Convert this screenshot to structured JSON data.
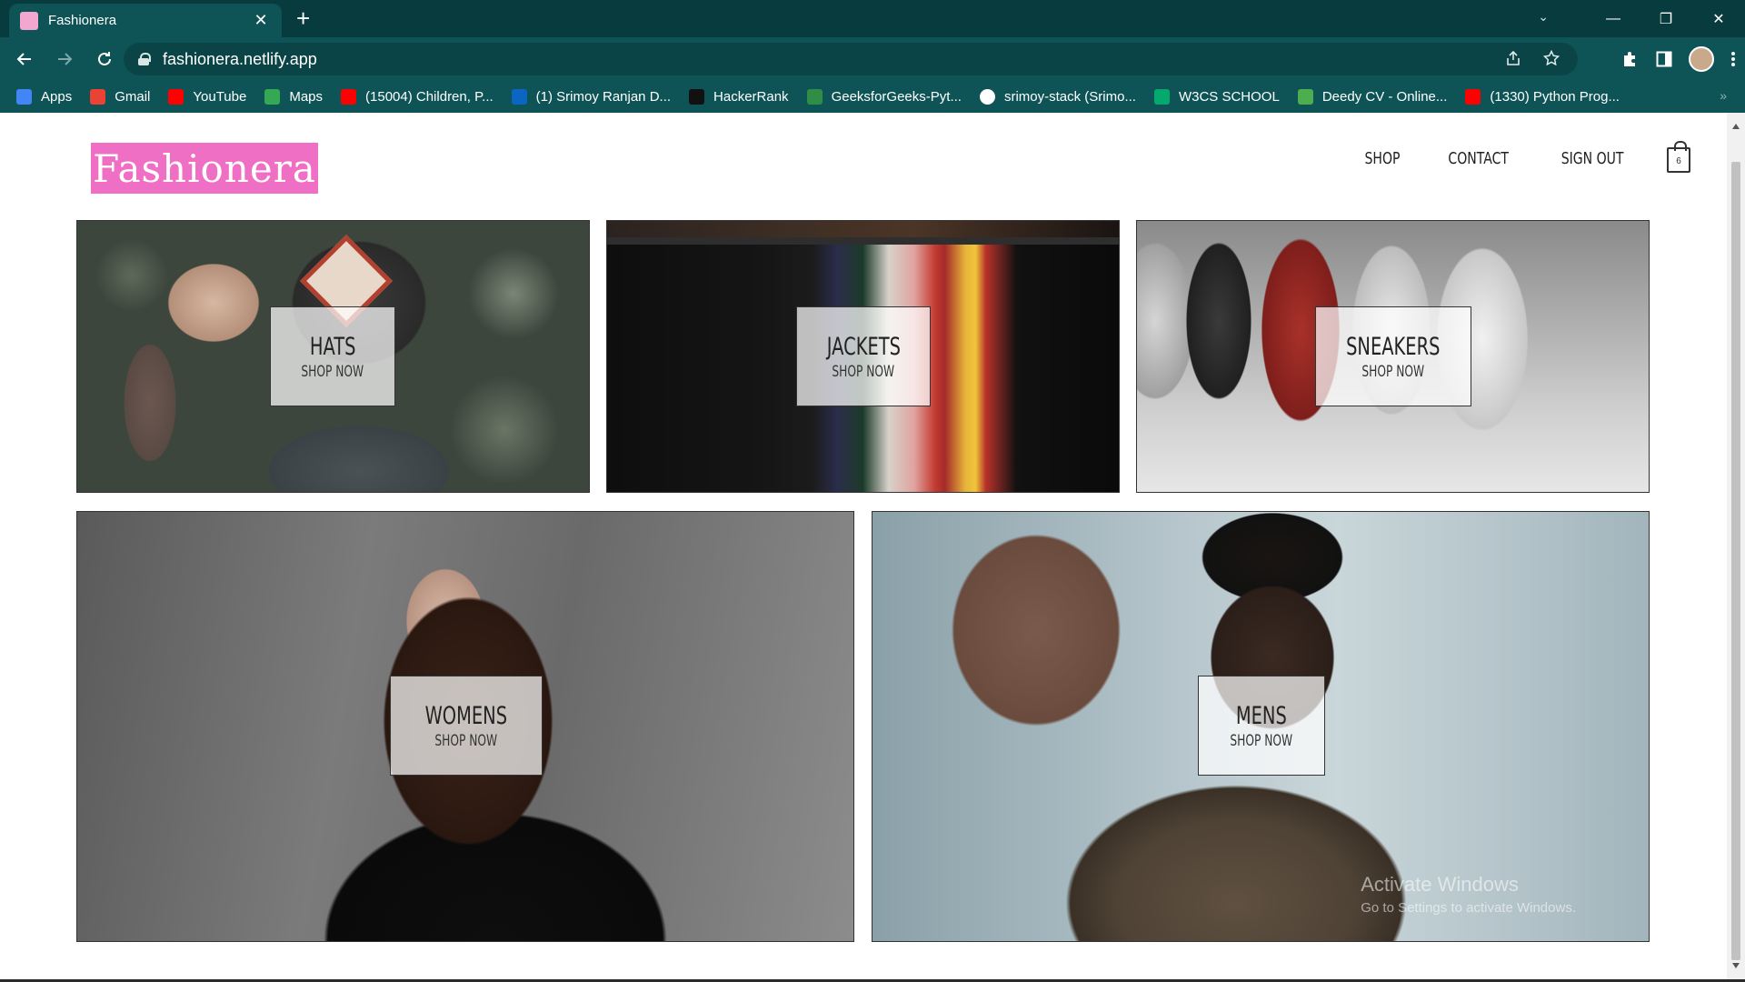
{
  "browser": {
    "tab_title": "Fashionera",
    "tab_close": "✕",
    "new_tab": "+",
    "url": "fashionera.netlify.app",
    "window_controls": {
      "minimize": "—",
      "restore": "❐",
      "close": "✕"
    },
    "tab_search": "⌄",
    "bookmarks": [
      {
        "label": "Apps",
        "icon": "apps-grid-icon",
        "color": "#4285f4"
      },
      {
        "label": "Gmail",
        "icon": "gmail-icon",
        "color": "#ea4335"
      },
      {
        "label": "YouTube",
        "icon": "youtube-icon",
        "color": "#ff0000"
      },
      {
        "label": "Maps",
        "icon": "maps-icon",
        "color": "#34a853"
      },
      {
        "label": "(15004) Children, P...",
        "icon": "youtube-icon",
        "color": "#ff0000"
      },
      {
        "label": "(1) Srimoy Ranjan D...",
        "icon": "linkedin-icon",
        "color": "#0a66c2"
      },
      {
        "label": "HackerRank",
        "icon": "hackerrank-icon",
        "color": "#111111"
      },
      {
        "label": "GeeksforGeeks-Pyt...",
        "icon": "geeksforgeeks-icon",
        "color": "#2f8d46"
      },
      {
        "label": "srimoy-stack (Srimo...",
        "icon": "github-icon",
        "color": "#ffffff"
      },
      {
        "label": "W3CS SCHOOL",
        "icon": "w3schools-icon",
        "color": "#04aa6d"
      },
      {
        "label": "Deedy CV - Online...",
        "icon": "overleaf-icon",
        "color": "#4cae4f"
      },
      {
        "label": "(1330) Python Prog...",
        "icon": "youtube-icon",
        "color": "#ff0000"
      }
    ],
    "bookmarks_more": "»"
  },
  "site": {
    "logo": "Fashionera",
    "nav": {
      "shop": "SHOP",
      "contact": "CONTACT",
      "sign_out": "SIGN OUT"
    },
    "cart_count": "6",
    "brand_color": "#ee6fc4",
    "categories": [
      {
        "title": "HATS",
        "cta": "SHOP NOW"
      },
      {
        "title": "JACKETS",
        "cta": "SHOP NOW"
      },
      {
        "title": "SNEAKERS",
        "cta": "SHOP NOW"
      },
      {
        "title": "WOMENS",
        "cta": "SHOP NOW"
      },
      {
        "title": "MENS",
        "cta": "SHOP NOW"
      }
    ]
  },
  "watermark": {
    "line1": "Activate Windows",
    "line2": "Go to Settings to activate Windows."
  }
}
